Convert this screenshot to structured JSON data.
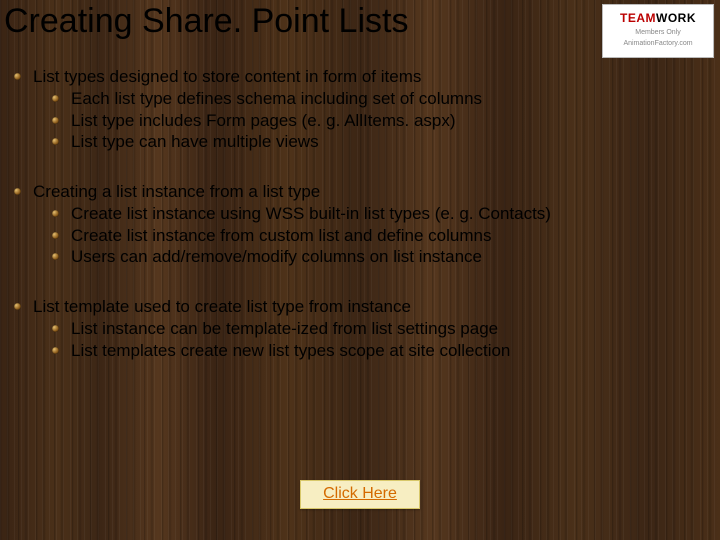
{
  "title_parts": {
    "a": "Creatin",
    "b": "g",
    "c": " Share. Point Lists"
  },
  "logo": {
    "brand1": "TEAM",
    "brand2": "WORK",
    "sub1": "Members Only",
    "sub2": "AnimationFactory.com"
  },
  "sections": [
    {
      "head": "List types designed to store content in form of items",
      "items": [
        "Each list type defines schema including set of columns",
        "List type includes Form pages (e. g. AllItems. aspx)",
        "List type can have multiple views"
      ]
    },
    {
      "head": "Creating a list instance from a list type",
      "items": [
        "Create list instance using WSS built-in list types (e. g. Contacts)",
        "Create list instance from custom list and define columns",
        "Users can add/remove/modify columns on list instance"
      ]
    },
    {
      "head": "List template used to create list type from instance",
      "items": [
        "List instance can be template-ized from list settings page",
        "List templates create new list types scope at site collection"
      ]
    }
  ],
  "cta": "Click Here"
}
